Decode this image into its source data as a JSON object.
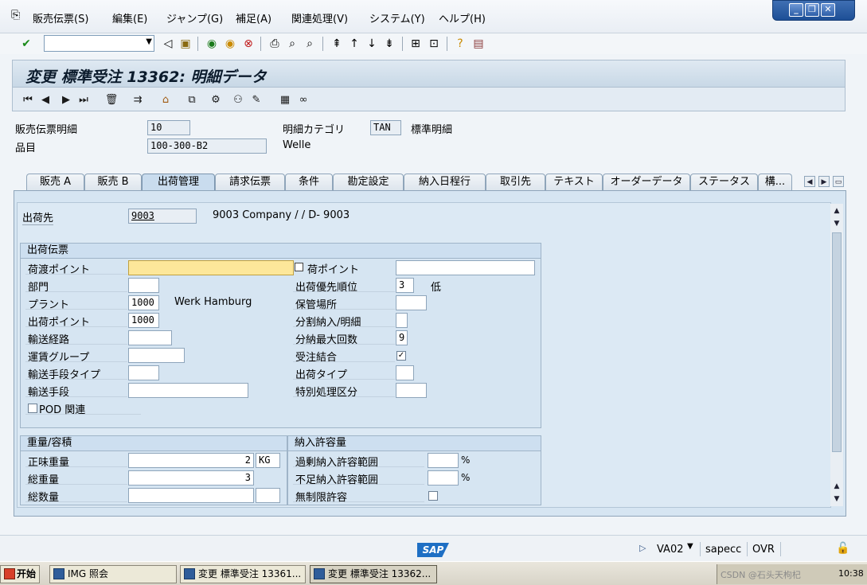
{
  "menu": {
    "items": [
      "販売伝票(S)",
      "編集(E)",
      "ジャンプ(G)",
      "補足(A)",
      "関連処理(V)",
      "システム(Y)",
      "ヘルプ(H)"
    ]
  },
  "window_controls": [
    "minimize",
    "maximize",
    "close"
  ],
  "toolbar": {
    "command_placeholder": ""
  },
  "title": "変更 標準受注 13362: 明細データ",
  "header": {
    "item_label": "販売伝票明細",
    "item_value": "10",
    "category_label": "明細カテゴリ",
    "category_value": "TAN",
    "category_text": "標準明細",
    "material_label": "品目",
    "material_value": "100-300-B2",
    "material_text": "Welle"
  },
  "tabs": [
    "販売 A",
    "販売 B",
    "出荷管理",
    "請求伝票",
    "条件",
    "勘定設定",
    "納入日程行",
    "取引先",
    "テキスト",
    "オーダーデータ",
    "ステータス",
    "構..."
  ],
  "active_tab": "出荷管理",
  "shipto": {
    "label": "出荷先",
    "value": "9003",
    "text": "9003 Company / / D- 9003"
  },
  "shipping_group": {
    "title": "出荷伝票",
    "left": {
      "loading_point_label": "荷渡ポイント",
      "loading_point_value": "",
      "division_label": "部門",
      "division_value": "",
      "plant_label": "プラント",
      "plant_value": "1000",
      "plant_text": "Werk Hamburg",
      "shipping_point_label": "出荷ポイント",
      "shipping_point_value": "1000",
      "route_label": "輸送経路",
      "route_value": "",
      "freight_group_label": "運賃グループ",
      "freight_group_value": "",
      "means_type_label": "輸送手段タイプ",
      "means_type_value": "",
      "means_label": "輸送手段",
      "means_value": "",
      "pod_label": "POD 関連",
      "pod_checked": false
    },
    "right": {
      "unload_point_label": "荷ポイント",
      "unload_point_value": "",
      "priority_label": "出荷優先順位",
      "priority_value": "3",
      "priority_text": "低",
      "storage_label": "保管場所",
      "storage_value": "",
      "partial_label": "分割納入/明細",
      "partial_value": "",
      "max_deliv_label": "分納最大回数",
      "max_deliv_value": "9",
      "combine_label": "受注結合",
      "combine_checked": true,
      "ship_type_label": "出荷タイプ",
      "ship_type_value": "",
      "special_label": "特別処理区分",
      "special_value": ""
    }
  },
  "weight_group": {
    "title": "重量/容積",
    "net_label": "正味重量",
    "net_value": "2",
    "net_unit": "KG",
    "gross_label": "総重量",
    "gross_value": "3",
    "volume_label": "総数量",
    "volume_value": "",
    "volume_unit": ""
  },
  "tolerance_group": {
    "title": "納入許容量",
    "over_label": "過剰納入許容範囲",
    "over_value": "",
    "over_unit": "%",
    "under_label": "不足納入許容範囲",
    "under_value": "",
    "under_unit": "%",
    "unlimited_label": "無制限許容",
    "unlimited_checked": false
  },
  "status": {
    "transaction": "VA02",
    "system": "sapecc",
    "mode": "OVR",
    "logo": "SAP"
  },
  "taskbar": {
    "start": "开始",
    "tasks": [
      "IMG 照会",
      "変更 標準受注 13361...",
      "変更 標準受注 13362..."
    ],
    "clock": "10:38",
    "watermark": "CSDN @石头天枸杞"
  }
}
